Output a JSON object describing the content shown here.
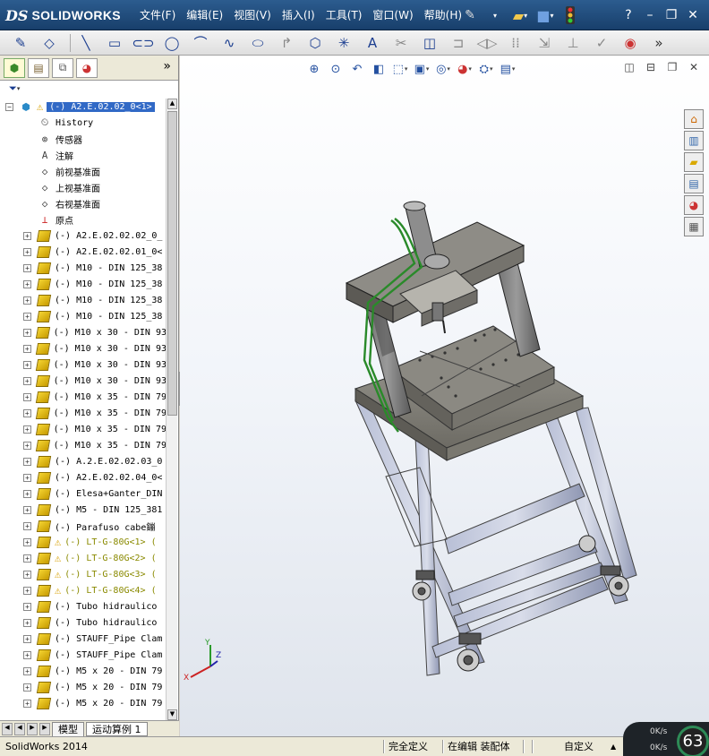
{
  "app": {
    "brand_ds": "DS",
    "brand_name": "SOLIDWORKS",
    "status_app": "SolidWorks 2014"
  },
  "menu": [
    "文件(F)",
    "编辑(E)",
    "视图(V)",
    "插入(I)",
    "工具(T)",
    "窗口(W)",
    "帮助(H)"
  ],
  "feature_tree": {
    "root": "(-) A2.E.02.02_0<1>",
    "features": [
      {
        "label": "History",
        "icon": "history-icon"
      },
      {
        "label": "传感器",
        "icon": "sensor-icon"
      },
      {
        "label": "注解",
        "icon": "annotation-icon"
      },
      {
        "label": "前视基准面",
        "icon": "plane-icon"
      },
      {
        "label": "上视基准面",
        "icon": "plane-icon"
      },
      {
        "label": "右视基准面",
        "icon": "plane-icon"
      },
      {
        "label": "原点",
        "icon": "origin-icon"
      }
    ],
    "components": [
      {
        "label": "(-) A2.E.02.02.02_0_",
        "warn": false
      },
      {
        "label": "(-) A2.E.02.02.01_0<",
        "warn": false
      },
      {
        "label": "(-) M10 - DIN 125_38",
        "warn": false
      },
      {
        "label": "(-) M10 - DIN 125_38",
        "warn": false
      },
      {
        "label": "(-) M10 - DIN 125_38",
        "warn": false
      },
      {
        "label": "(-) M10 - DIN 125_38",
        "warn": false
      },
      {
        "label": "(-) M10 x 30 - DIN 93",
        "warn": false
      },
      {
        "label": "(-) M10 x 30 - DIN 93",
        "warn": false
      },
      {
        "label": "(-) M10 x 30 - DIN 93",
        "warn": false
      },
      {
        "label": "(-) M10 x 30 - DIN 93",
        "warn": false
      },
      {
        "label": "(-) M10 x 35 - DIN 79",
        "warn": false
      },
      {
        "label": "(-) M10 x 35 - DIN 79",
        "warn": false
      },
      {
        "label": "(-) M10 x 35 - DIN 79",
        "warn": false
      },
      {
        "label": "(-) M10 x 35 - DIN 79",
        "warn": false
      },
      {
        "label": "(-) A.2.E.02.02.03_0",
        "warn": false
      },
      {
        "label": "(-) A2.E.02.02.04_0<",
        "warn": false
      },
      {
        "label": "(-) Elesa+Ganter_DIN",
        "warn": false
      },
      {
        "label": "(-) M5 - DIN 125_381",
        "warn": false
      },
      {
        "label": "(-) Parafuso cabe鏰",
        "warn": false
      },
      {
        "label": "(-) LT-G-80G<1> (",
        "warn": true
      },
      {
        "label": "(-) LT-G-80G<2> (",
        "warn": true
      },
      {
        "label": "(-) LT-G-80G<3> (",
        "warn": true
      },
      {
        "label": "(-) LT-G-80G<4> (",
        "warn": true
      },
      {
        "label": "(-) Tubo hidraulico",
        "warn": false
      },
      {
        "label": "(-) Tubo hidraulico",
        "warn": false
      },
      {
        "label": "(-) STAUFF_Pipe Clam",
        "warn": false
      },
      {
        "label": "(-) STAUFF_Pipe Clam",
        "warn": false
      },
      {
        "label": "(-) M5 x 20 - DIN 79",
        "warn": false
      },
      {
        "label": "(-) M5 x 20 - DIN 79",
        "warn": false
      },
      {
        "label": "(-) M5 x 20 - DIN 79",
        "warn": false
      }
    ]
  },
  "bottom_tabs": [
    "模型",
    "运动算例 1"
  ],
  "status": {
    "fully_defined": "完全定义",
    "editing": "在编辑 装配体",
    "custom": "自定义",
    "net_up": "0K/s",
    "net_down": "0K/s",
    "cpu_percent": "63"
  },
  "triad": {
    "x": "X",
    "y": "Y",
    "z": "Z"
  },
  "colors": {
    "title_bg": "#1f4a7a",
    "selected_bg": "#3169c6",
    "frame_gray": "#9aa4c0",
    "plate": "#8a8880",
    "hose": "#2a8a2a"
  }
}
